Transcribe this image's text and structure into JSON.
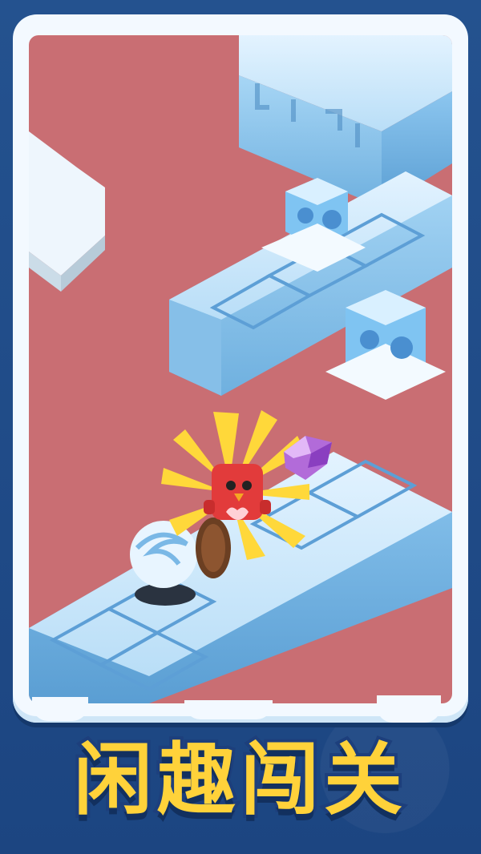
{
  "title": {
    "text": "闲趣闯关"
  },
  "colors": {
    "background": "#1e4b8a",
    "floor": "#c96e73",
    "tile_top": "#cfe9fb",
    "tile_side": "#8fc6ea",
    "title_fill": "#ffd23a",
    "title_stroke": "#1d3f7c"
  },
  "scene": {
    "character": "red-bird-player",
    "collectible": "purple-gem",
    "obstacles": [
      "ice-block",
      "ice-block",
      "whirlwind-trap",
      "wooden-shield"
    ]
  }
}
